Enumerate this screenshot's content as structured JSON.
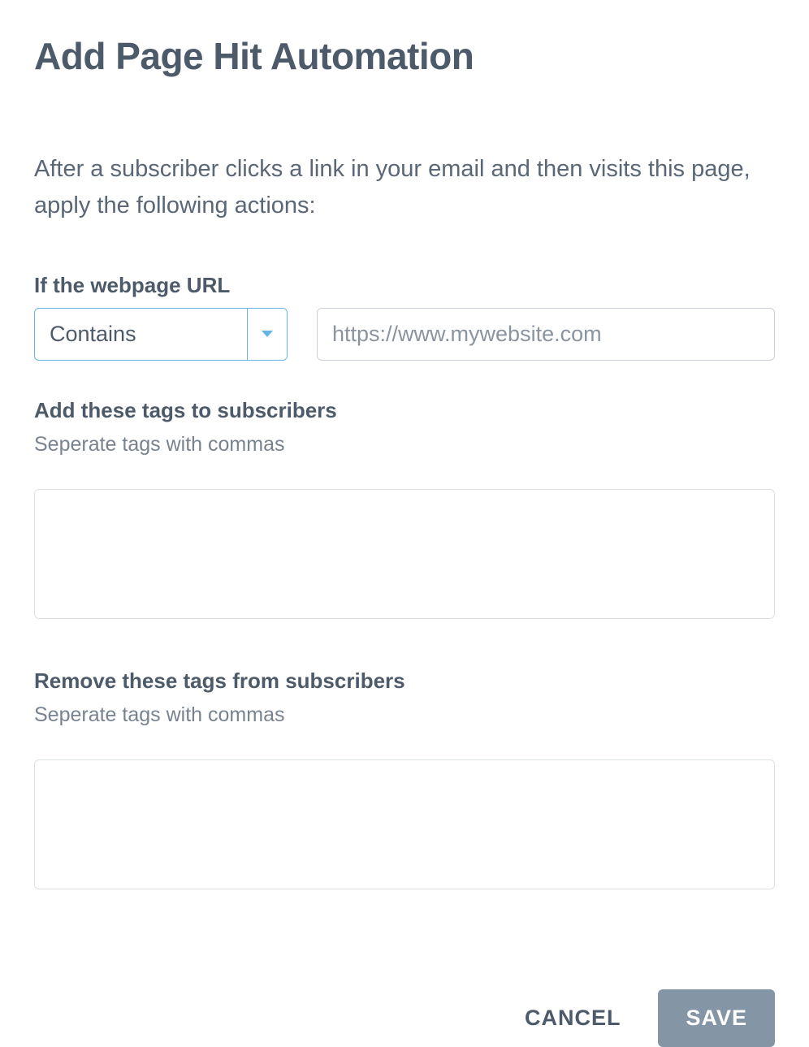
{
  "title": "Add Page Hit Automation",
  "intro": "After a subscriber clicks a link in your email and then visits this page, apply the following actions:",
  "url_section": {
    "label": "If the webpage URL",
    "select_value": "Contains",
    "input_placeholder": "https://www.mywebsite.com",
    "input_value": ""
  },
  "add_tags": {
    "label": "Add these tags to subscribers",
    "sublabel": "Seperate tags with commas",
    "value": ""
  },
  "remove_tags": {
    "label": "Remove these tags from subscribers",
    "sublabel": "Seperate tags with commas",
    "value": ""
  },
  "footer": {
    "cancel_label": "CANCEL",
    "save_label": "SAVE"
  }
}
